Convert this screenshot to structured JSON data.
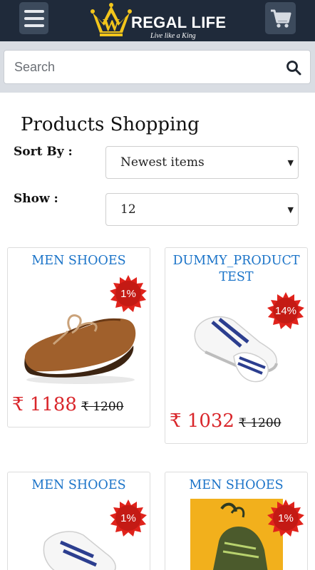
{
  "header": {
    "brand": "REGAL LIFE",
    "tagline": "Live like a King",
    "menu_icon": "hamburger-menu-icon",
    "cart_icon": "shopping-cart-icon",
    "background_color": "#1f2a3a",
    "accent_color": "#f2c51b"
  },
  "search": {
    "placeholder": "Search",
    "value": "",
    "icon": "search-icon"
  },
  "listing": {
    "title": "Products Shopping",
    "sort_label": "Sort By :",
    "sort_value": "Newest items",
    "show_label": "Show :",
    "show_value": "12"
  },
  "products": [
    {
      "name": "MEN SHOOES",
      "discount": "1%",
      "price": "₹ 1188",
      "old_price": "₹ 1200",
      "image": "brown-loafer-shoe"
    },
    {
      "name": "DUMMY_PRODUCTTEST",
      "discount": "14%",
      "price": "₹ 1032",
      "old_price": "₹ 1200",
      "image": "white-sneaker-shoe"
    },
    {
      "name": "MEN SHOOES",
      "discount": "1%",
      "image": "white-sneaker-shoe"
    },
    {
      "name": "MEN SHOOES",
      "discount": "1%",
      "image": "green-hightop-shoe"
    }
  ],
  "colors": {
    "title_blue": "#1a73c8",
    "price_red": "#d9262b",
    "badge_red": "#e0231c"
  }
}
